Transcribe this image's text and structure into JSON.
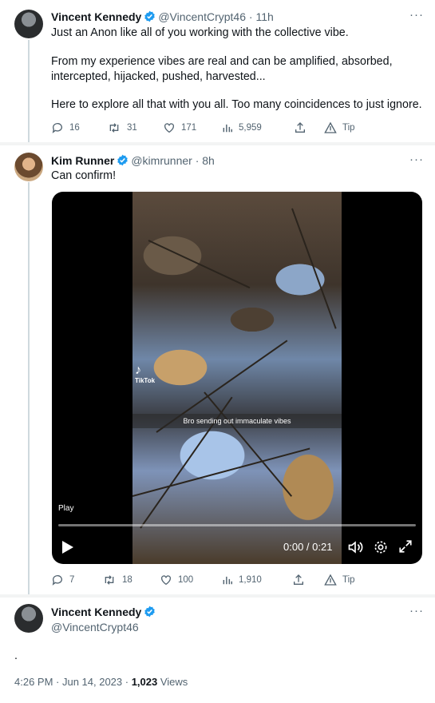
{
  "tweet1": {
    "name": "Vincent Kennedy",
    "handle": "@VincentCrypt46",
    "sep": "·",
    "time": "11h",
    "more": "···",
    "lines": [
      "Just an Anon like all of you working with the collective vibe.",
      "From my experience vibes are real and can be amplified, absorbed,",
      "intercepted, hijacked, pushed, harvested...",
      "Here to explore all that with you all. Too many coincidences to just ignore."
    ],
    "actions": {
      "replies": "16",
      "retweets": "31",
      "likes": "171",
      "views": "5,959",
      "tip": "Tip"
    }
  },
  "tweet2": {
    "name": "Kim Runner",
    "handle": "@kimrunner",
    "sep": "·",
    "time": "8h",
    "more": "···",
    "text": "Can confirm!",
    "video": {
      "tiktok_label": "TikTok",
      "caption": "Bro sending out immaculate vibes",
      "play_label": "Play",
      "timecode": "0:00 / 0:21"
    },
    "actions": {
      "replies": "7",
      "retweets": "18",
      "likes": "100",
      "views": "1,910",
      "tip": "Tip"
    }
  },
  "tweet3": {
    "name": "Vincent Kennedy",
    "handle": "@VincentCrypt46",
    "more": "···",
    "body": ".",
    "timestamp": "4:26 PM · Jun 14, 2023 · ",
    "views_count": "1,023",
    "views_label": " Views"
  },
  "colors": {
    "accent": "#1d9bf0",
    "muted": "#536471",
    "text": "#0f1419",
    "divider": "#cfd9de"
  }
}
